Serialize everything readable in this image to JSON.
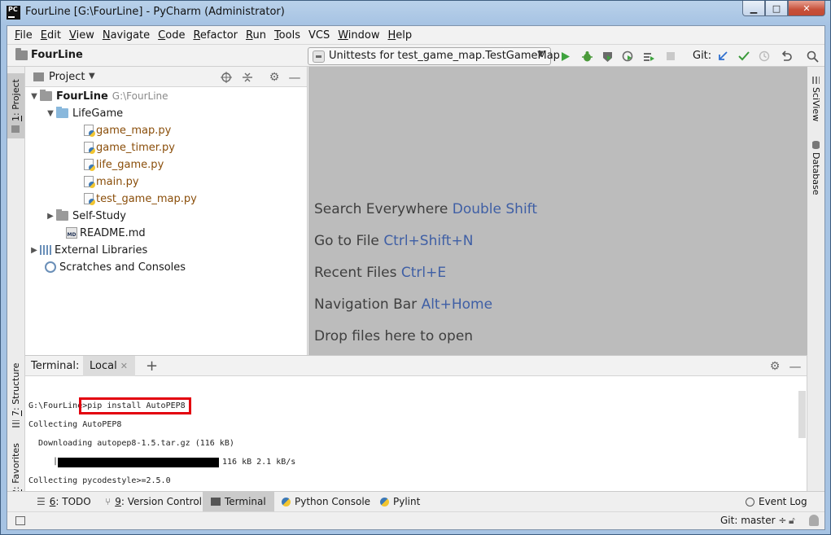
{
  "window": {
    "logo": "PC",
    "title": "FourLine [G:\\FourLine] - PyCharm (Administrator)",
    "minimize": "▁",
    "maximize": "□",
    "close": "✕"
  },
  "menu": [
    {
      "u": "F",
      "rest": "ile"
    },
    {
      "u": "E",
      "rest": "dit"
    },
    {
      "u": "V",
      "rest": "iew"
    },
    {
      "u": "N",
      "rest": "avigate"
    },
    {
      "u": "C",
      "rest": "ode"
    },
    {
      "u": "R",
      "rest": "efactor"
    },
    {
      "u": "R",
      "rest": "un"
    },
    {
      "u": "T",
      "rest": "ools"
    },
    {
      "u": "",
      "rest": "VCS"
    },
    {
      "u": "W",
      "rest": "indow"
    },
    {
      "u": "H",
      "rest": "elp"
    }
  ],
  "nav": {
    "project": "FourLine",
    "run_config": "Unittests for test_game_map.TestGameMap",
    "git_label": "Git:",
    "colors": {
      "run": "#3fa33f",
      "debug": "#4a9a3a",
      "vcs": "#2f6fcf",
      "check": "#3a9a3a"
    }
  },
  "left_strip": {
    "project_tab": {
      "num": "1",
      "label": ": Project"
    },
    "structure_tab": {
      "num": "7",
      "label": ": Structure"
    },
    "favorites_tab": {
      "num": "2",
      "label": ": Favorites"
    }
  },
  "right_strip": {
    "sciview": "SciView",
    "database": "Database"
  },
  "project": {
    "header": "Project",
    "tree": {
      "root": {
        "name": "FourLine",
        "path": "G:\\FourLine"
      },
      "lifegame": "LifeGame",
      "files": [
        "game_map.py",
        "game_timer.py",
        "life_game.py",
        "main.py",
        "test_game_map.py"
      ],
      "self_study": "Self-Study",
      "readme": "README.md",
      "readme_badge": "MD",
      "external": "External Libraries",
      "scratches": "Scratches and Consoles"
    }
  },
  "editor_hints": [
    {
      "text": "Search Everywhere",
      "key": "Double Shift"
    },
    {
      "text": "Go to File",
      "key": "Ctrl+Shift+N"
    },
    {
      "text": "Recent Files",
      "key": "Ctrl+E"
    },
    {
      "text": "Navigation Bar",
      "key": "Alt+Home"
    },
    {
      "text": "Drop files here to open",
      "key": ""
    }
  ],
  "terminal": {
    "label": "Terminal:",
    "tab": "Local",
    "prompt": "G:\\FourLine>",
    "command": "pip install AutoPEP8",
    "lines": [
      "Collecting AutoPEP8",
      "  Downloading autopep8-1.5.tar.gz (116 kB)",
      "116 kB 2.1 kB/s",
      "Collecting pycodestyle>=2.5.0"
    ],
    "progress_fraction": 1.0
  },
  "bottom_tabs": [
    {
      "num": "6",
      "label": ": TODO"
    },
    {
      "num": "9",
      "label": ": Version Control"
    },
    {
      "num": "",
      "label": "Terminal"
    },
    {
      "num": "",
      "label": "Python Console"
    },
    {
      "num": "",
      "label": "Pylint"
    }
  ],
  "event_log": "Event Log",
  "status": {
    "git_branch": "Git: master ÷"
  }
}
